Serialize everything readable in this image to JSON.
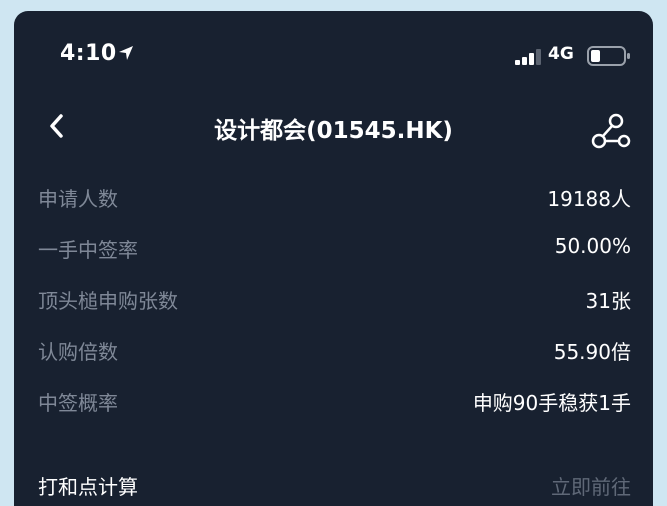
{
  "status_bar": {
    "time": "4:10",
    "network": "4G",
    "icons": [
      "location-arrow-icon",
      "signal-icon",
      "battery-icon"
    ]
  },
  "nav": {
    "title": "设计都会(01545.HK)",
    "back_icon": "chevron-left-icon",
    "share_icon": "share-icon"
  },
  "info_rows": [
    {
      "label": "申请人数",
      "value": "19188人"
    },
    {
      "label": "一手中签率",
      "value": "50.00%"
    },
    {
      "label": "顶头槌申购张数",
      "value": "31张"
    },
    {
      "label": "认购倍数",
      "value": "55.90倍"
    },
    {
      "label": "中签概率",
      "value": "申购90手稳获1手"
    }
  ],
  "calculator": {
    "label": "打和点计算",
    "link": "立即前往"
  },
  "colors": {
    "background": "#182130",
    "label": "#7f8897",
    "value": "#ffffff",
    "muted_link": "#5f6877"
  }
}
